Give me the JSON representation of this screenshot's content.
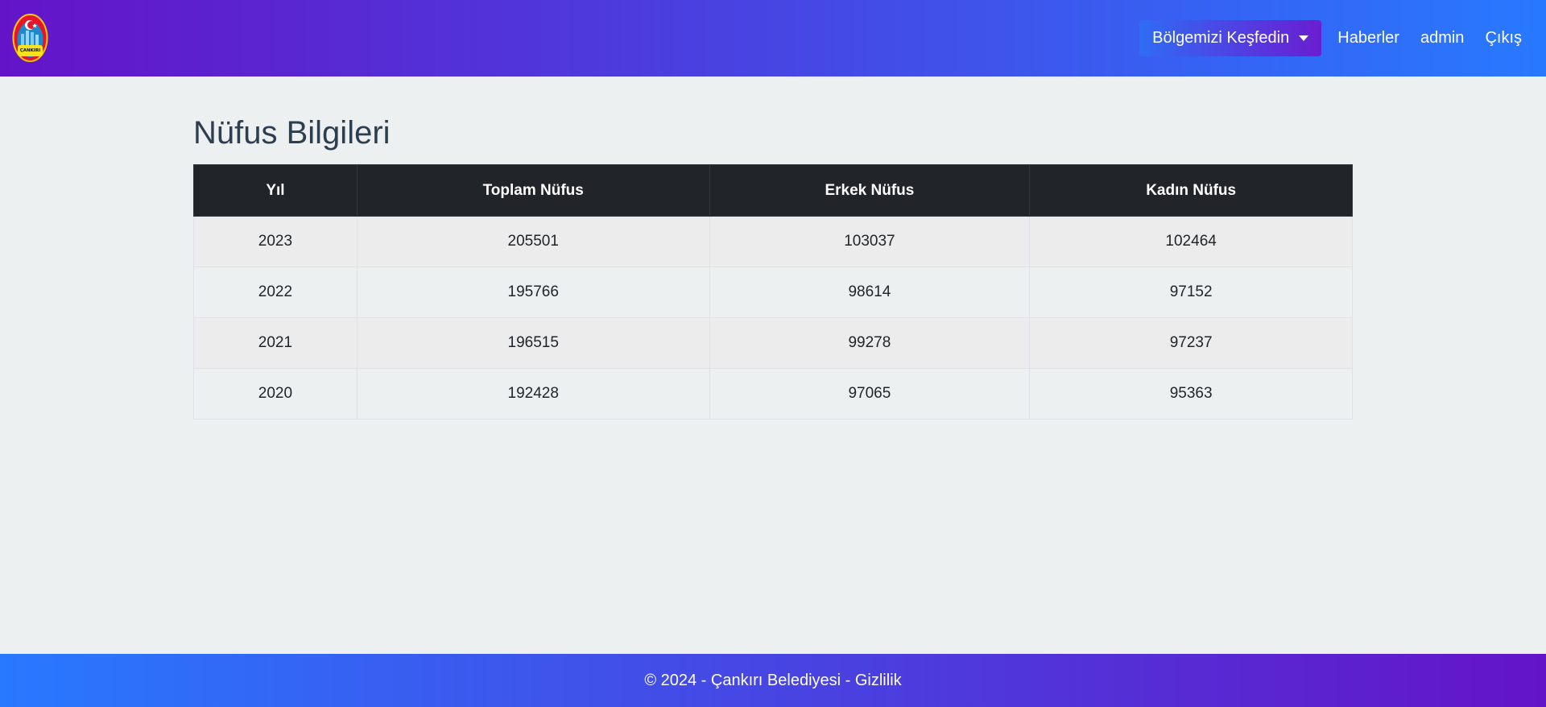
{
  "header": {
    "nav": {
      "dropdown_label": "Bölgemizi Keşfedin",
      "news_label": "Haberler",
      "user_label": "admin",
      "logout_label": "Çıkış"
    },
    "logo_text": "ÇANKIRI"
  },
  "main": {
    "title": "Nüfus Bilgileri",
    "table": {
      "headers": [
        "Yıl",
        "Toplam Nüfus",
        "Erkek Nüfus",
        "Kadın Nüfus"
      ],
      "rows": [
        [
          "2023",
          "205501",
          "103037",
          "102464"
        ],
        [
          "2022",
          "195766",
          "98614",
          "97152"
        ],
        [
          "2021",
          "196515",
          "99278",
          "97237"
        ],
        [
          "2020",
          "192428",
          "97065",
          "95363"
        ]
      ]
    }
  },
  "footer": {
    "text": "© 2024 - Çankırı Belediyesi - Gizlilik"
  },
  "colors": {
    "header_dark": "#212529",
    "title": "#2c3e50",
    "background": "#ecf0f1"
  }
}
